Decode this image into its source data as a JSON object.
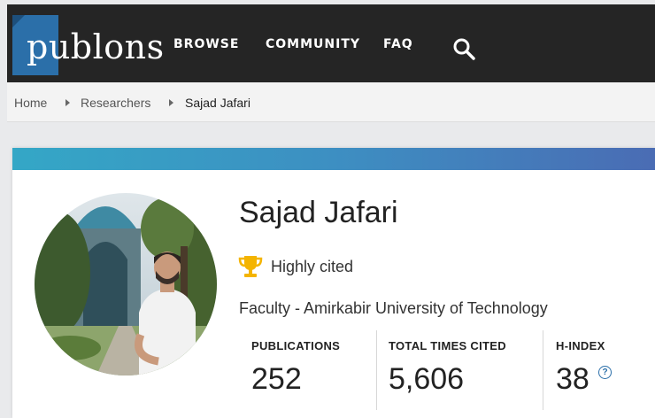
{
  "nav": {
    "logo_text": "publons",
    "links": [
      "BROWSE",
      "COMMUNITY",
      "FAQ"
    ],
    "search_icon": "search-icon"
  },
  "breadcrumb": [
    "Home",
    "Researchers",
    "Sajad Jafari"
  ],
  "profile": {
    "name": "Sajad Jafari",
    "badge": "Highly cited",
    "badge_icon": "trophy-icon",
    "affiliation": "Faculty - Amirkabir University of Technology",
    "metrics": [
      {
        "label": "PUBLICATIONS",
        "value": "252"
      },
      {
        "label": "TOTAL TIMES CITED",
        "value": "5,606"
      },
      {
        "label": "H-INDEX",
        "value": "38",
        "help_icon": "question-circle-icon"
      }
    ]
  },
  "colors": {
    "nav_bg": "#252525",
    "logo_blue": "#2b6fa9",
    "accent_start": "#34a7c6",
    "accent_end": "#4a6cb4",
    "trophy_gold": "#f4b400"
  }
}
